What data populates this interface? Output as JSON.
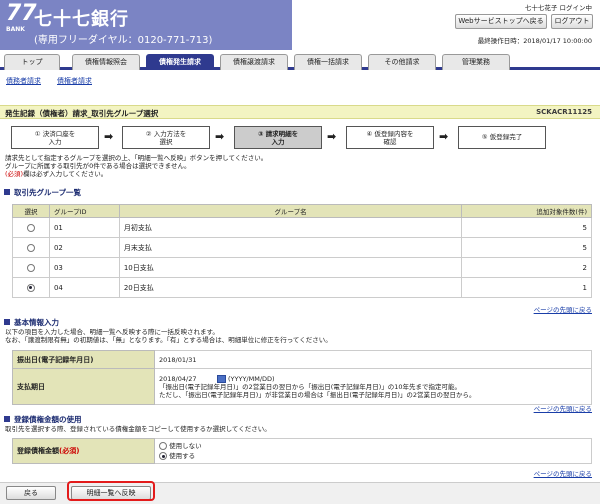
{
  "header": {
    "logo_number": "77",
    "logo_sub": "BANK",
    "bank_name": "七十七銀行",
    "phone": "(専用フリーダイヤル：0120-771-713)",
    "user": "七十七花子 ログイン中",
    "top_button": "Webサービストップへ戻る",
    "logout_button": "ログアウト",
    "last_login": "最終操作日時：2018/01/17 10:00:00"
  },
  "nav": {
    "tabs": [
      "トップ",
      "債権情報照会",
      "債権発生請求",
      "債権譲渡請求",
      "債権一括請求",
      "その他請求",
      "管理業務"
    ],
    "active_index": 2
  },
  "subnav": {
    "links": [
      "債務者請求",
      "債権者請求"
    ]
  },
  "page": {
    "title": "発生記録（債権者）請求_取引先グループ選択",
    "screen_id": "SCKACR11125"
  },
  "steps": [
    "① 決済口座を\n入力",
    "② 入力方法を\n選択",
    "③ 請求明細を\n入力",
    "④ 仮登録内容を\n確認",
    "⑤ 仮登録完了"
  ],
  "active_step": 2,
  "instructions": {
    "line1": "請求先として指定するグループを選択の上、「明細一覧へ反映」ボタンを押してください。",
    "line2": "グループに所属する取引先が0件である場合は選択できません。",
    "required_mark": "(必須)",
    "line3": "欄は必ず入力してください。"
  },
  "group_section": {
    "title": "取引先グループ一覧",
    "headers": [
      "選択",
      "グループID",
      "グループ名",
      "追加対象件数(件)"
    ],
    "rows": [
      {
        "id": "01",
        "name": "月初支払",
        "count": "5",
        "selected": false
      },
      {
        "id": "02",
        "name": "月末支払",
        "count": "5",
        "selected": false
      },
      {
        "id": "03",
        "name": "10日支払",
        "count": "2",
        "selected": false
      },
      {
        "id": "04",
        "name": "20日支払",
        "count": "1",
        "selected": true
      }
    ],
    "page_top": "ページの先頭に戻る"
  },
  "basic_section": {
    "title": "基本情報入力",
    "note1": "以下の項目を入力した場合、明細一覧へ反映する際に一括反映されます。",
    "note2": "なお、「譲渡制限有無」の初期値は、「無」となります。「有」とする場合は、明細単位に修正を行ってください。",
    "issue_label": "振出日(電子記録年月日)",
    "issue_value": "2018/01/31",
    "due_label": "支払期日",
    "due_value": "2018/04/27",
    "due_format": "(YYYY/MM/DD)",
    "due_note1": "「振出日(電子記録年月日)」の2営業日の翌日から「振出日(電子記録年月日)」の10年先まで指定可能。",
    "due_note2": "ただし、「振出日(電子記録年月日)」が非営業日の場合は「振出日(電子記録年月日)」の2営業日の翌日から。",
    "page_top": "ページの先頭に戻る"
  },
  "register_section": {
    "title": "登録債権金額の使用",
    "note": "取引先を選択する際、登録されている債権金額をコピーして使用するか選択してください。",
    "label": "登録債権金額",
    "required_mark": "(必須)",
    "opt_no": "使用しない",
    "opt_yes": "使用する",
    "selected": "yes",
    "page_top": "ページの先頭に戻る"
  },
  "footer": {
    "back_button": "戻る",
    "apply_button": "明細一覧へ反映"
  },
  "colors": {
    "accent": "#2f3a8f",
    "logo_bg": "#7b84c4",
    "title_bg": "#f3f4c2",
    "highlight": "#e31b1b"
  }
}
